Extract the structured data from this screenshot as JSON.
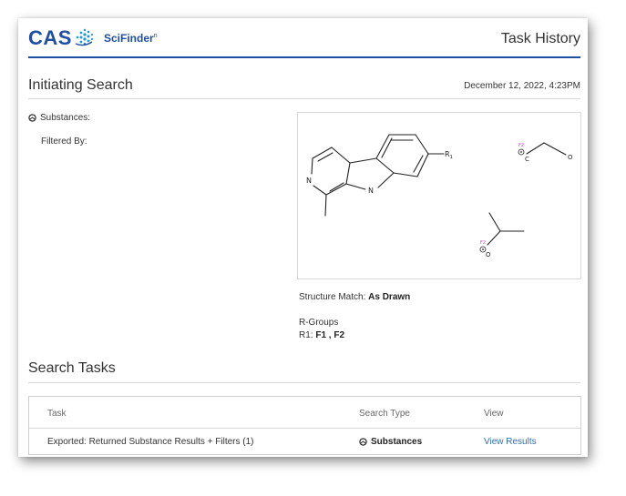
{
  "header": {
    "logo_text": "CAS",
    "product_name": "SciFinder",
    "product_suffix": "n",
    "page_title": "Task History",
    "brand_color": "#1f4ea3"
  },
  "initiating": {
    "title": "Initiating Search",
    "date": "December 12, 2022, 4:23PM",
    "substances_label": "Substances:",
    "filtered_by_label": "Filtered By:",
    "structure_labels": {
      "r1": "R",
      "r1_sub": "1",
      "n_ring": "N",
      "n_pyrrole": "N",
      "f2_a": "F2",
      "c_atom": "C",
      "o_atom_a": "O",
      "f2_b": "F2",
      "o_atom_b": "O"
    },
    "structure_match_label": "Structure Match:",
    "structure_match_value": "As Drawn",
    "rgroups_label": "R-Groups",
    "r1_label": "R1:",
    "r1_value": "F1 , F2"
  },
  "tasks": {
    "title": "Search Tasks",
    "columns": [
      "Task",
      "Search Type",
      "View"
    ],
    "rows": [
      {
        "task": "Exported: Returned Substance Results + Filters (1)",
        "search_type": "Substances",
        "view": "View Results"
      }
    ],
    "link_color": "#2f6db5",
    "magenta_label_color": "#d23bd2"
  }
}
